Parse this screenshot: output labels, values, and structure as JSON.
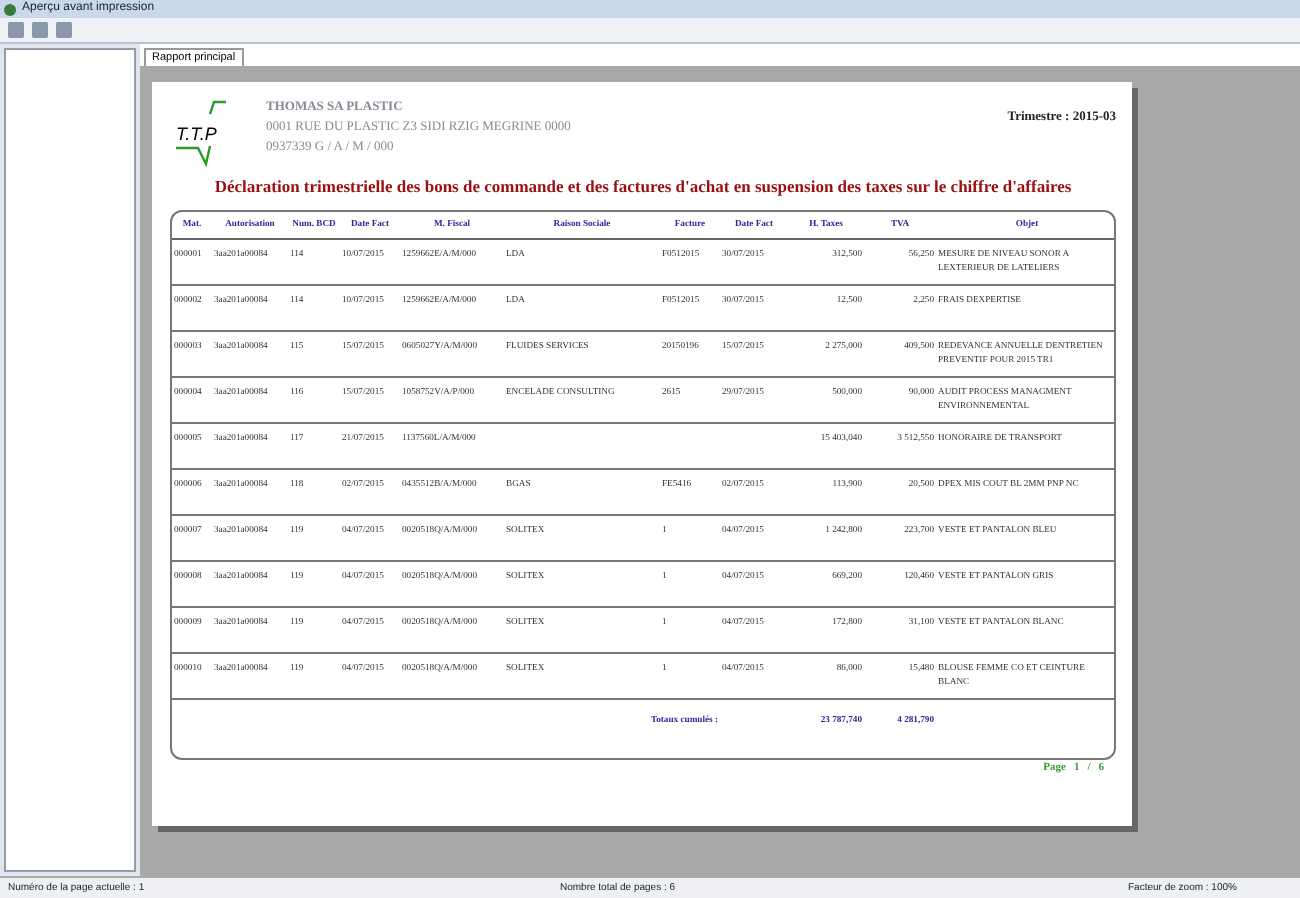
{
  "window": {
    "title": "Aperçu avant impression"
  },
  "tabs": [
    {
      "label": "Rapport principal",
      "selected": true
    }
  ],
  "report": {
    "logo": "T.T.P",
    "company": [
      "THOMAS SA PLASTIC",
      "0001 RUE DU PLASTIC Z3 SIDI RZIG MEGRINE 0000",
      "0937339 G / A / M / 000"
    ],
    "quarter": "Trimestre : 2015-03",
    "title": "Déclaration trimestrielle des bons de commande et des factures d'achat en suspension des taxes sur le chiffre d'affaires",
    "columns": [
      "Mat.",
      "Autorisation",
      "Num. BCD",
      "Date Fact",
      "M. Fiscal",
      "Raison Sociale",
      "Facture",
      "Date Fact",
      "H. Taxes",
      "TVA",
      "Objet"
    ],
    "rows": [
      [
        "000001",
        "3aa201a00084",
        "114",
        "10/07/2015",
        "1259662E/A/M/000",
        "LDA",
        "F0512015",
        "30/07/2015",
        "312,500",
        "56,250",
        "MESURE DE NIVEAU SONOR A LEXTERIEUR DE LATELIERS"
      ],
      [
        "000002",
        "3aa201a00084",
        "114",
        "10/07/2015",
        "1259662E/A/M/000",
        "LDA",
        "F0512015",
        "30/07/2015",
        "12,500",
        "2,250",
        "FRAIS DEXPERTISE"
      ],
      [
        "000003",
        "3aa201a00084",
        "115",
        "15/07/2015",
        "0605027Y/A/M/000",
        "FLUIDES SERVICES",
        "20150196",
        "15/07/2015",
        "2 275,000",
        "409,500",
        "REDEVANCE ANNUELLE DENTRETIEN PREVENTIF POUR 2015 TR1"
      ],
      [
        "000004",
        "3aa201a00084",
        "116",
        "15/07/2015",
        "1058752V/A/P/000",
        "ENCELADE CONSULTING",
        "2615",
        "29/07/2015",
        "500,000",
        "90,000",
        "AUDIT PROCESS MANAGMENT ENVIRONNEMENTAL"
      ],
      [
        "000005",
        "3aa201a00084",
        "117",
        "21/07/2015",
        "1137560L/A/M/000",
        "",
        "",
        "",
        "15 403,040",
        "3 512,550",
        "HONORAIRE DE TRANSPORT"
      ],
      [
        "000006",
        "3aa201a00084",
        "118",
        "02/07/2015",
        "0435512B/A/M/000",
        "BGAS",
        "FE5416",
        "02/07/2015",
        "113,900",
        "20,500",
        "DPEX MIS COUT BL 2MM PNP NC"
      ],
      [
        "000007",
        "3aa201a00084",
        "119",
        "04/07/2015",
        "0020518Q/A/M/000",
        "SOLITEX",
        "1",
        "04/07/2015",
        "1 242,800",
        "223,700",
        "VESTE ET PANTALON BLEU"
      ],
      [
        "000008",
        "3aa201a00084",
        "119",
        "04/07/2015",
        "0020518Q/A/M/000",
        "SOLITEX",
        "1",
        "04/07/2015",
        "669,200",
        "120,460",
        "VESTE ET PANTALON GRIS"
      ],
      [
        "000009",
        "3aa201a00084",
        "119",
        "04/07/2015",
        "0020518Q/A/M/000",
        "SOLITEX",
        "1",
        "04/07/2015",
        "172,800",
        "31,100",
        "VESTE ET PANTALON BLANC"
      ],
      [
        "000010",
        "3aa201a00084",
        "119",
        "04/07/2015",
        "0020518Q/A/M/000",
        "SOLITEX",
        "1",
        "04/07/2015",
        "86,000",
        "15,480",
        "BLOUSE FEMME CO ET CEINTURE BLANC"
      ]
    ],
    "totals": {
      "label": "Totaux cumulés :",
      "h_taxes": "23 787,740",
      "tva": "4 281,790"
    },
    "page": {
      "label": "Page",
      "current": "1",
      "separator": "/",
      "total": "6"
    }
  },
  "status_bar": [
    "Numéro de la page actuelle : 1",
    "Nombre total de pages : 6",
    "Facteur de zoom : 100%"
  ]
}
